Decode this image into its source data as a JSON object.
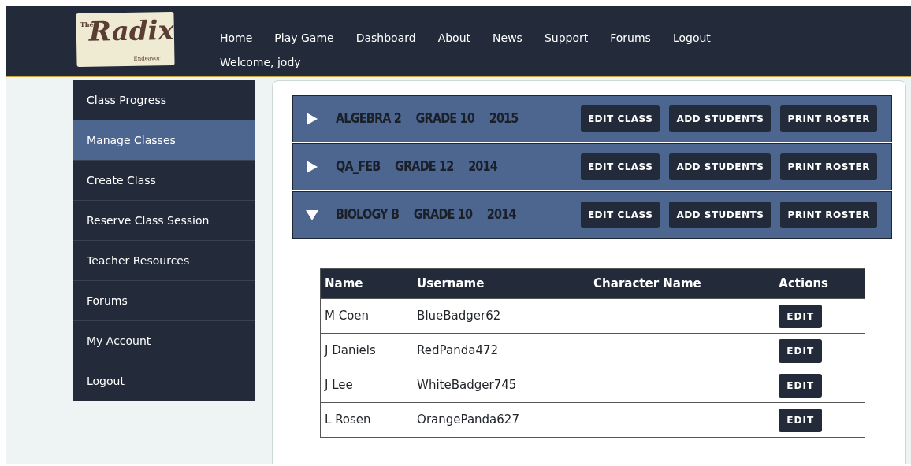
{
  "logo": {
    "small_top": "The",
    "main": "Radix",
    "small_bottom": "Endeavor"
  },
  "nav": [
    {
      "label": "Home"
    },
    {
      "label": "Play Game"
    },
    {
      "label": "Dashboard"
    },
    {
      "label": "About"
    },
    {
      "label": "News"
    },
    {
      "label": "Support"
    },
    {
      "label": "Forums"
    },
    {
      "label": "Logout"
    }
  ],
  "welcome": {
    "text": "Welcome, ",
    "user": "jody"
  },
  "sidebar": {
    "items": [
      {
        "label": "Class Progress",
        "selected": false
      },
      {
        "label": "Manage Classes",
        "selected": true
      },
      {
        "label": "Create Class",
        "selected": false
      },
      {
        "label": "Reserve Class Session",
        "selected": false
      },
      {
        "label": "Teacher Resources",
        "selected": false
      },
      {
        "label": "Forums",
        "selected": false
      },
      {
        "label": "My Account",
        "selected": false
      },
      {
        "label": "Logout",
        "selected": false
      }
    ]
  },
  "classes": [
    {
      "name": "ALGEBRA 2",
      "grade": "GRADE 10",
      "year": "2015",
      "expanded": false,
      "buttons": [
        "EDIT CLASS",
        "ADD STUDENTS",
        "PRINT ROSTER"
      ]
    },
    {
      "name": "QA_FEB",
      "grade": "GRADE 12",
      "year": "2014",
      "expanded": false,
      "buttons": [
        "EDIT CLASS",
        "ADD STUDENTS",
        "PRINT ROSTER"
      ]
    },
    {
      "name": "BIOLOGY B",
      "grade": "GRADE 10",
      "year": "2014",
      "expanded": true,
      "buttons": [
        "EDIT CLASS",
        "ADD STUDENTS",
        "PRINT ROSTER"
      ],
      "table": {
        "columns": [
          "Name",
          "Username",
          "Character Name",
          "Actions"
        ],
        "rows": [
          {
            "name": "M Coen",
            "username": "BlueBadger62",
            "action": "EDIT"
          },
          {
            "name": "J Daniels",
            "username": "RedPanda472",
            "action": "EDIT"
          },
          {
            "name": "J Lee",
            "username": "WhiteBadger745",
            "action": "EDIT"
          },
          {
            "name": "L Rosen",
            "username": "OrangePanda627",
            "action": "EDIT"
          }
        ]
      }
    }
  ]
}
